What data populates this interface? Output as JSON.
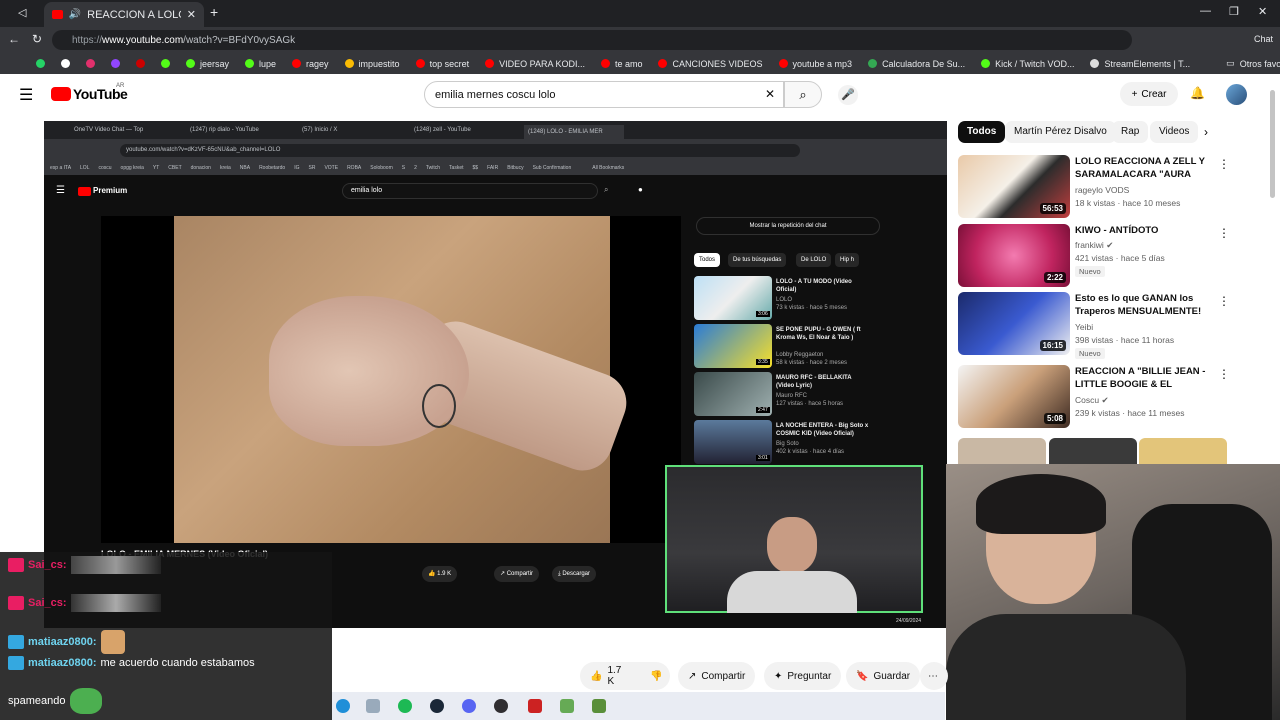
{
  "browser": {
    "tab_title": "REACCION A LOLO - EMILIA M",
    "url_prefix": "https://",
    "url_domain": "www.youtube.com",
    "url_path": "/watch?v=BFdY0vySAGk",
    "chat_label": "Chat",
    "bookmarks": [
      "jeersay",
      "lupe",
      "ragey",
      "impuestito",
      "top secret",
      "VIDEO PARA KODI...",
      "te amo",
      "CANCIONES VIDEOS",
      "youtube a mp3",
      "Calculadora De Su...",
      "Kick / Twitch VOD...",
      "StreamElements | T..."
    ],
    "other_favorites": "Otros favoritos"
  },
  "youtube": {
    "logo": "YouTube",
    "logo_region": "AR",
    "search_value": "emilia mernes coscu lolo",
    "create_label": "Crear",
    "chips": [
      "Todos",
      "Martín Pérez Disalvo",
      "Rap",
      "Videos"
    ],
    "recommendations": [
      {
        "title": "LOLO REACCIONA A ZELL Y SARAMALACARA \"AURA TAL...",
        "channel": "rageylo VODS",
        "meta": "18 k vistas · hace 10 meses",
        "duration": "56:53",
        "badge": ""
      },
      {
        "title": "KIWO - ANTÍDOTO",
        "channel": "frankiwi",
        "meta": "421 vistas · hace 5 días",
        "duration": "2:22",
        "badge": "Nuevo"
      },
      {
        "title": "Esto es lo que GANAN los Traperos MENSUALMENTE!",
        "channel": "Yeibi",
        "meta": "398 vistas · hace 11 horas",
        "duration": "16:15",
        "badge": "Nuevo"
      },
      {
        "title": "REACCION A \"BILLIE JEAN - LITTLE BOOGIE & EL DOCTOR\"",
        "channel": "Coscu",
        "meta": "239 k vistas · hace 11 meses",
        "duration": "5:08",
        "badge": ""
      }
    ],
    "actions": {
      "likes": "1.7 K",
      "share": "Compartir",
      "ask": "Preguntar",
      "save": "Guardar"
    }
  },
  "inner": {
    "tabs": [
      "OneTV Video Chat — Top",
      "(1247) rip dialo - YouTube",
      "(57) Inicio / X",
      "(1248) zell - YouTube",
      "(1248) LOLO - EMILIA MER"
    ],
    "url": "youtube.com/watch?v=dKzVF-65cNU&ab_channel=LOLO",
    "bookmarks": [
      "esp a ITA",
      "LOL",
      "coscu",
      "opgg kreia",
      "YT",
      "CBET",
      "donacion",
      "kreia",
      "NBA",
      "Roobetardo",
      "IG",
      "SR",
      "VOTE",
      "ROBA",
      "Soloboom",
      "S",
      "2",
      "Twitch",
      "Tasket",
      "$$",
      "FAIR",
      "Bitbucy",
      "Sub Confirmation",
      "All Bookmarks"
    ],
    "premium": "Premium",
    "search_value": "emilia lolo",
    "show_chat": "Mostrar la repetición del chat",
    "chips": [
      "Todos",
      "De tus búsquedas",
      "De LOLO",
      "Hip h"
    ],
    "video_title": "LOLO - EMILIA MERNES (Video Oficial)",
    "likes": "1.9 K",
    "share": "Compartir",
    "download": "Descargar",
    "date": "24/09/2024",
    "recs": [
      {
        "title": "LOLO - A TU MODO (Video Oficial)",
        "channel": "LOLO",
        "meta": "73 k vistas · hace 5 meses",
        "duration": "3:06"
      },
      {
        "title": "SE PONE PUPU - G OWEN ( ft Kroma Ws, El Noar & Taio )",
        "channel": "Lobby Reggaeton",
        "meta": "58 k vistas · hace 2 meses",
        "duration": "3:35"
      },
      {
        "title": "MAURO RFC - BELLAKITA (Video Lyric)",
        "channel": "Mauro RFC",
        "meta": "127 vistas · hace 5 horas",
        "duration": "2:47"
      },
      {
        "title": "LA NOCHE ENTERA - Big Soto x COSMIC KID (Video Oficial)",
        "channel": "Big Soto",
        "meta": "402 k vistas · hace 4 días",
        "duration": "3:01"
      }
    ]
  },
  "chat": {
    "lines": [
      {
        "user": "Sai_cs:",
        "text": ""
      },
      {
        "user": "Sai_cs:",
        "text": ""
      },
      {
        "user": "matiaaz0800:",
        "text": ""
      },
      {
        "user": "matiaaz0800:",
        "text": "me acuerdo cuando estabamos"
      },
      {
        "user": "",
        "text": "spameando"
      }
    ]
  }
}
